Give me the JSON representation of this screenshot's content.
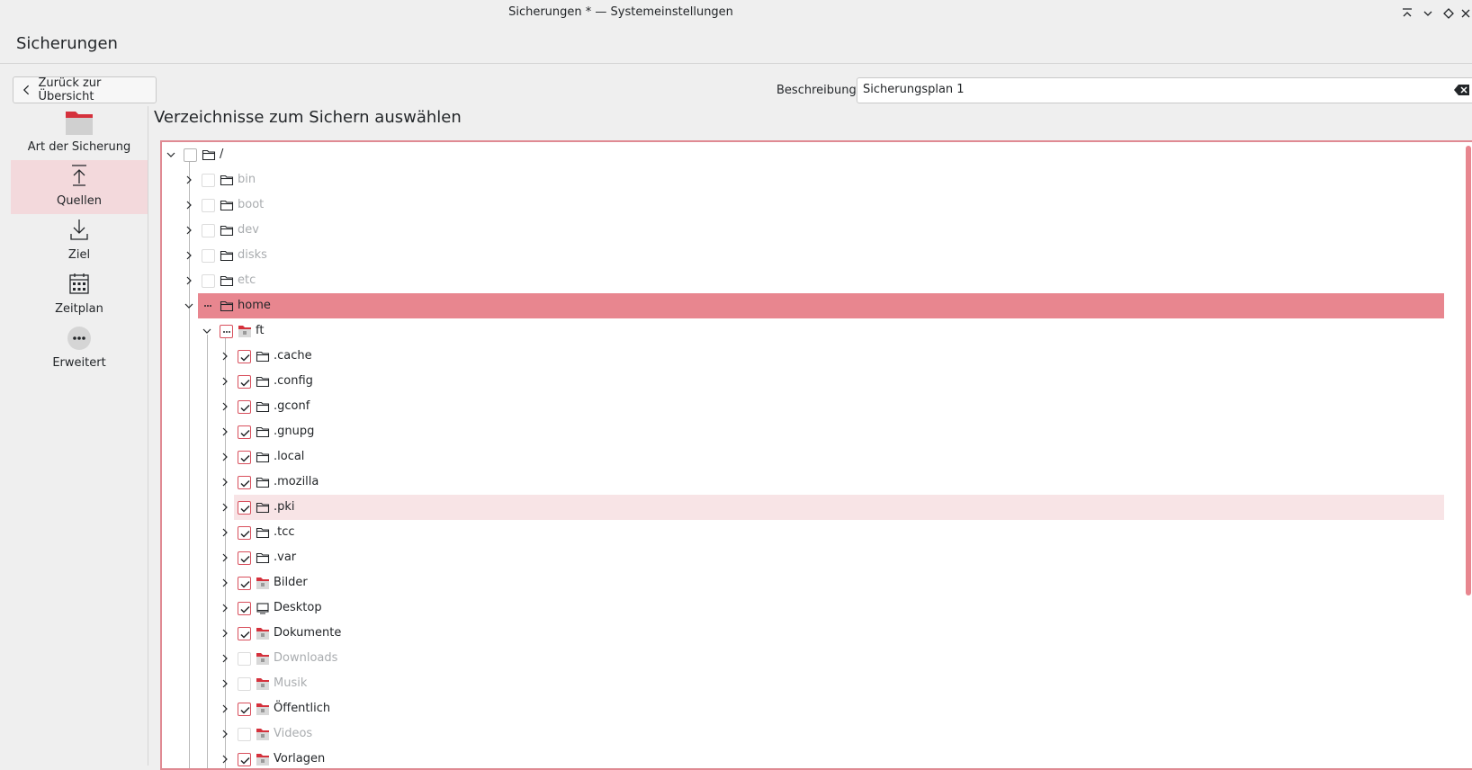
{
  "window": {
    "title": "Sicherungen * — Systemeinstellungen",
    "controls": [
      "minimize-all-icon",
      "minimize-icon",
      "maximize-icon",
      "close-icon"
    ]
  },
  "page": {
    "title": "Sicherungen"
  },
  "back_button": {
    "label": "Zurück zur Übersicht"
  },
  "sidebar": {
    "items": [
      {
        "label": "Art der Sicherung",
        "icon": "folder-red-icon",
        "active": false
      },
      {
        "label": "Quellen",
        "icon": "upload-icon",
        "active": true
      },
      {
        "label": "Ziel",
        "icon": "download-icon",
        "active": false
      },
      {
        "label": "Zeitplan",
        "icon": "calendar-icon",
        "active": false
      },
      {
        "label": "Erweitert",
        "icon": "more-icon",
        "active": false
      }
    ]
  },
  "description": {
    "label": "Beschreibung:",
    "value": "Sicherungsplan 1"
  },
  "section": {
    "title": "Verzeichnisse zum Sichern auswählen"
  },
  "accent": "#e8868f",
  "tree": {
    "rows": [
      {
        "name": "/",
        "depth": 0,
        "expanded": true,
        "state": "unchecked",
        "icon": "folder-icon",
        "dim": false
      },
      {
        "name": "bin",
        "depth": 1,
        "expanded": false,
        "state": "disabled",
        "icon": "folder-icon",
        "dim": true
      },
      {
        "name": "boot",
        "depth": 1,
        "expanded": false,
        "state": "disabled",
        "icon": "folder-icon",
        "dim": true
      },
      {
        "name": "dev",
        "depth": 1,
        "expanded": false,
        "state": "disabled",
        "icon": "folder-icon",
        "dim": true
      },
      {
        "name": "disks",
        "depth": 1,
        "expanded": false,
        "state": "disabled",
        "icon": "folder-icon",
        "dim": true
      },
      {
        "name": "etc",
        "depth": 1,
        "expanded": false,
        "state": "disabled",
        "icon": "folder-icon",
        "dim": true
      },
      {
        "name": "home",
        "depth": 1,
        "expanded": true,
        "state": "partial",
        "icon": "folder-icon",
        "dim": false,
        "selected": true
      },
      {
        "name": "ft",
        "depth": 2,
        "expanded": true,
        "state": "partial",
        "icon": "folder-home-icon",
        "dim": false
      },
      {
        "name": ".cache",
        "depth": 3,
        "expanded": false,
        "state": "checked",
        "icon": "folder-icon",
        "dim": false
      },
      {
        "name": ".config",
        "depth": 3,
        "expanded": false,
        "state": "checked",
        "icon": "folder-icon",
        "dim": false
      },
      {
        "name": ".gconf",
        "depth": 3,
        "expanded": false,
        "state": "checked",
        "icon": "folder-icon",
        "dim": false
      },
      {
        "name": ".gnupg",
        "depth": 3,
        "expanded": false,
        "state": "checked",
        "icon": "folder-icon",
        "dim": false
      },
      {
        "name": ".local",
        "depth": 3,
        "expanded": false,
        "state": "checked",
        "icon": "folder-icon",
        "dim": false
      },
      {
        "name": ".mozilla",
        "depth": 3,
        "expanded": false,
        "state": "checked",
        "icon": "folder-icon",
        "dim": false
      },
      {
        "name": ".pki",
        "depth": 3,
        "expanded": false,
        "state": "checked",
        "icon": "folder-icon",
        "dim": false,
        "hover": true
      },
      {
        "name": ".tcc",
        "depth": 3,
        "expanded": false,
        "state": "checked",
        "icon": "folder-icon",
        "dim": false
      },
      {
        "name": ".var",
        "depth": 3,
        "expanded": false,
        "state": "checked",
        "icon": "folder-icon",
        "dim": false
      },
      {
        "name": "Bilder",
        "depth": 3,
        "expanded": false,
        "state": "checked",
        "icon": "folder-pictures-icon",
        "dim": false
      },
      {
        "name": "Desktop",
        "depth": 3,
        "expanded": false,
        "state": "checked",
        "icon": "desktop-icon",
        "dim": false
      },
      {
        "name": "Dokumente",
        "depth": 3,
        "expanded": false,
        "state": "checked",
        "icon": "folder-documents-icon",
        "dim": false
      },
      {
        "name": "Downloads",
        "depth": 3,
        "expanded": false,
        "state": "disabled",
        "icon": "folder-downloads-icon",
        "dim": true
      },
      {
        "name": "Musik",
        "depth": 3,
        "expanded": false,
        "state": "disabled",
        "icon": "folder-music-icon",
        "dim": true
      },
      {
        "name": "Öffentlich",
        "depth": 3,
        "expanded": false,
        "state": "checked",
        "icon": "folder-public-icon",
        "dim": false
      },
      {
        "name": "Videos",
        "depth": 3,
        "expanded": false,
        "state": "disabled",
        "icon": "folder-videos-icon",
        "dim": true
      },
      {
        "name": "Vorlagen",
        "depth": 3,
        "expanded": false,
        "state": "checked",
        "icon": "folder-templates-icon",
        "dim": false
      }
    ]
  }
}
